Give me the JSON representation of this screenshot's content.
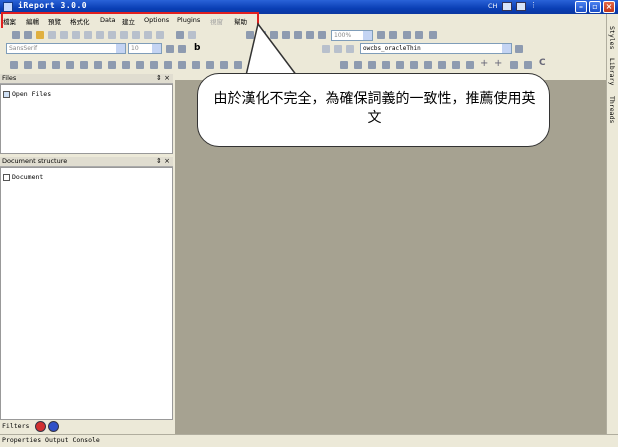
{
  "window": {
    "title": "iReport 3.0.0"
  },
  "system_tray": {
    "input_lang": "CH"
  },
  "menu": {
    "items": [
      {
        "label": "檔案"
      },
      {
        "label": "編輯"
      },
      {
        "label": "預覽"
      },
      {
        "label": "格式化"
      },
      {
        "label": "Data"
      },
      {
        "label": "建立"
      },
      {
        "label": "Options"
      },
      {
        "label": "Plugins"
      },
      {
        "label": "視窗",
        "disabled": true
      },
      {
        "label": "幫助"
      }
    ]
  },
  "toolbar": {
    "font_family": "SansSerif",
    "font_size": "10",
    "zoom": "100%",
    "datasource": "owcbs_oracleThin"
  },
  "files_panel": {
    "title": "Files",
    "items": [
      "Open Files"
    ]
  },
  "structure_panel": {
    "title": "Document structure",
    "items": [
      "Document"
    ]
  },
  "right_tabs": [
    "Styles",
    "Library",
    "Threads"
  ],
  "filters": {
    "label": "Filters"
  },
  "status_bar": {
    "text": "Properties Output Console"
  },
  "callout": {
    "text": "由於漢化不完全，為確保詞義的一致性，推薦使用英文"
  },
  "colors": {
    "title_blue": "#0a3fb5",
    "workarea": "#a6a291",
    "highlight_red": "#e02020"
  }
}
